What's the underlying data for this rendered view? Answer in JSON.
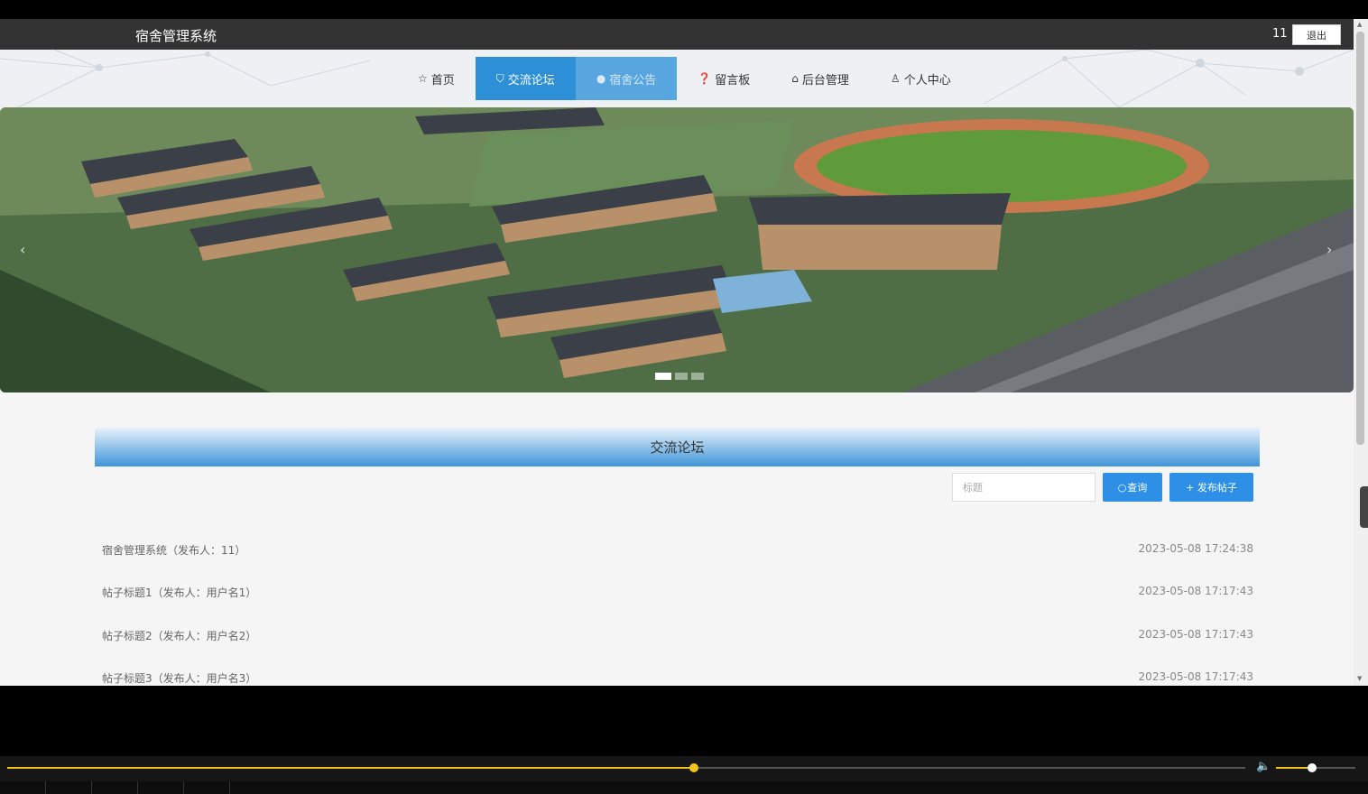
{
  "header": {
    "site_title": "宿舍管理系统",
    "user_name": "11",
    "logout_label": "退出"
  },
  "nav": {
    "items": [
      {
        "icon": "star-icon",
        "glyph": "☆",
        "label": "首页",
        "state": "normal"
      },
      {
        "icon": "bag-icon",
        "glyph": "⛉",
        "label": "交流论坛",
        "state": "active"
      },
      {
        "icon": "info-icon",
        "glyph": "●",
        "label": "宿舍公告",
        "state": "hover"
      },
      {
        "icon": "question-icon",
        "glyph": "❓",
        "label": "留言板",
        "state": "normal"
      },
      {
        "icon": "building-icon",
        "glyph": "⌂",
        "label": "后台管理",
        "state": "normal"
      },
      {
        "icon": "user-icon",
        "glyph": "♙",
        "label": "个人中心",
        "state": "normal"
      }
    ]
  },
  "banner": {
    "prev_glyph": "‹",
    "next_glyph": "›",
    "slide_count": 3,
    "active_slide": 1
  },
  "forum": {
    "section_title": "交流论坛",
    "search_placeholder": "标题",
    "query_label": "查询",
    "post_label": "+ 发布帖子",
    "posts": [
      {
        "title": "宿舍管理系统（发布人：11）",
        "date": "2023-05-08 17:24:38"
      },
      {
        "title": "帖子标题1（发布人：用户名1）",
        "date": "2023-05-08 17:17:43"
      },
      {
        "title": "帖子标题2（发布人：用户名2）",
        "date": "2023-05-08 17:17:43"
      },
      {
        "title": "帖子标题3（发布人：用户名3）",
        "date": "2023-05-08 17:17:43"
      }
    ]
  },
  "player": {
    "progress": 0.555,
    "volume": 0.45
  },
  "colors": {
    "accent": "#2d8fd5",
    "player_accent": "#f0c419",
    "topbar": "#333333"
  }
}
